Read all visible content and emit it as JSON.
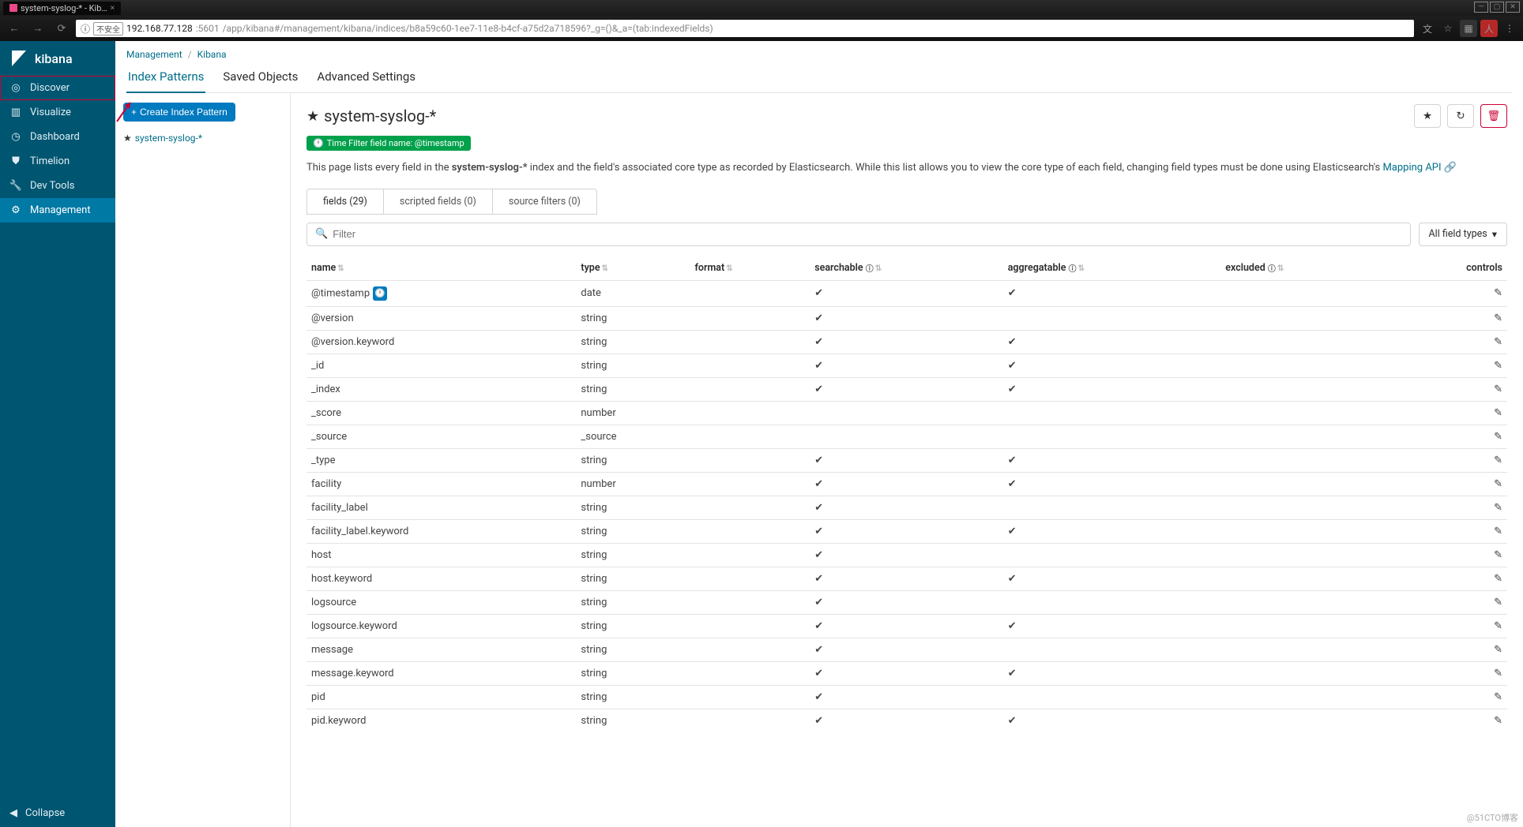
{
  "browser": {
    "tab_title": "system-syslog-* - Kib…",
    "security_label": "不安全",
    "url_host": "192.168.77.128",
    "url_port": ":5601",
    "url_path": "/app/kibana#/management/kibana/indices/b8a59c60-1ee7-11e8-b4cf-a75d2a718596?_g=()&_a=(tab:indexedFields)"
  },
  "app_name": "kibana",
  "sidebar": {
    "items": [
      {
        "label": "Discover"
      },
      {
        "label": "Visualize"
      },
      {
        "label": "Dashboard"
      },
      {
        "label": "Timelion"
      },
      {
        "label": "Dev Tools"
      },
      {
        "label": "Management"
      }
    ],
    "collapse": "Collapse"
  },
  "breadcrumb": {
    "a": "Management",
    "b": "Kibana"
  },
  "top_tabs": [
    {
      "label": "Index Patterns"
    },
    {
      "label": "Saved Objects"
    },
    {
      "label": "Advanced Settings"
    }
  ],
  "left_pane": {
    "create_btn": "Create Index Pattern",
    "saved_pattern": "system-syslog-*"
  },
  "page": {
    "title": "system-syslog-*",
    "time_filter_badge": "Time Filter field name: @timestamp",
    "desc_prefix": "This page lists every field in the ",
    "desc_bold": "system-syslog-*",
    "desc_mid": " index and the field's associated core type as recorded by Elasticsearch. While this list allows you to view the core type of each field, changing field types must be done using Elasticsearch's ",
    "desc_link": "Mapping API"
  },
  "sub_tabs": [
    {
      "label": "fields (29)"
    },
    {
      "label": "scripted fields (0)"
    },
    {
      "label": "source filters (0)"
    }
  ],
  "filter_placeholder": "Filter",
  "field_types_label": "All field types",
  "columns": {
    "name": "name",
    "type": "type",
    "format": "format",
    "searchable": "searchable",
    "aggregatable": "aggregatable",
    "excluded": "excluded",
    "controls": "controls"
  },
  "rows": [
    {
      "name": "@timestamp",
      "type": "date",
      "clock": true,
      "searchable": true,
      "aggregatable": true,
      "excluded": false
    },
    {
      "name": "@version",
      "type": "string",
      "searchable": true,
      "aggregatable": false,
      "excluded": false
    },
    {
      "name": "@version.keyword",
      "type": "string",
      "searchable": true,
      "aggregatable": true,
      "excluded": false
    },
    {
      "name": "_id",
      "type": "string",
      "searchable": true,
      "aggregatable": true,
      "excluded": false
    },
    {
      "name": "_index",
      "type": "string",
      "searchable": true,
      "aggregatable": true,
      "excluded": false
    },
    {
      "name": "_score",
      "type": "number",
      "searchable": false,
      "aggregatable": false,
      "excluded": false
    },
    {
      "name": "_source",
      "type": "_source",
      "searchable": false,
      "aggregatable": false,
      "excluded": false
    },
    {
      "name": "_type",
      "type": "string",
      "searchable": true,
      "aggregatable": true,
      "excluded": false
    },
    {
      "name": "facility",
      "type": "number",
      "searchable": true,
      "aggregatable": true,
      "excluded": false
    },
    {
      "name": "facility_label",
      "type": "string",
      "searchable": true,
      "aggregatable": false,
      "excluded": false
    },
    {
      "name": "facility_label.keyword",
      "type": "string",
      "searchable": true,
      "aggregatable": true,
      "excluded": false
    },
    {
      "name": "host",
      "type": "string",
      "searchable": true,
      "aggregatable": false,
      "excluded": false
    },
    {
      "name": "host.keyword",
      "type": "string",
      "searchable": true,
      "aggregatable": true,
      "excluded": false
    },
    {
      "name": "logsource",
      "type": "string",
      "searchable": true,
      "aggregatable": false,
      "excluded": false
    },
    {
      "name": "logsource.keyword",
      "type": "string",
      "searchable": true,
      "aggregatable": true,
      "excluded": false
    },
    {
      "name": "message",
      "type": "string",
      "searchable": true,
      "aggregatable": false,
      "excluded": false
    },
    {
      "name": "message.keyword",
      "type": "string",
      "searchable": true,
      "aggregatable": true,
      "excluded": false
    },
    {
      "name": "pid",
      "type": "string",
      "searchable": true,
      "aggregatable": false,
      "excluded": false
    },
    {
      "name": "pid.keyword",
      "type": "string",
      "searchable": true,
      "aggregatable": true,
      "excluded": false
    }
  ],
  "watermark": "@51CTO博客"
}
